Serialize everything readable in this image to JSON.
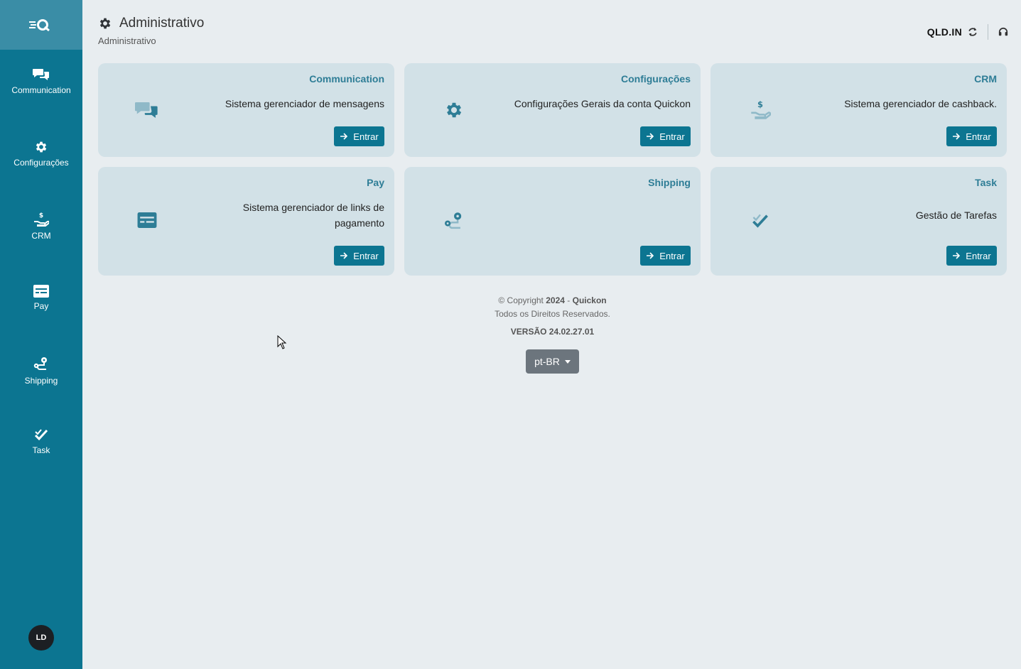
{
  "sidebar": {
    "logo": "logo-icon",
    "items": [
      {
        "label": "Communication",
        "icon": "chat-icon"
      },
      {
        "label": "Configurações",
        "icon": "gear-icon"
      },
      {
        "label": "CRM",
        "icon": "cashback-hand-icon"
      },
      {
        "label": "Pay",
        "icon": "card-icon"
      },
      {
        "label": "Shipping",
        "icon": "route-icon"
      },
      {
        "label": "Task",
        "icon": "check-icon"
      }
    ],
    "avatar": "LD"
  },
  "header": {
    "title": "Administrativo",
    "breadcrumb": "Administrativo",
    "org": "QLD.IN"
  },
  "cards": [
    {
      "title": "Communication",
      "description": "Sistema gerenciador de mensagens",
      "button": "Entrar",
      "icon": "chat-icon"
    },
    {
      "title": "Configurações",
      "description": "Configurações Gerais da conta Quickon",
      "button": "Entrar",
      "icon": "gear-icon"
    },
    {
      "title": "CRM",
      "description": "Sistema gerenciador de cashback.",
      "button": "Entrar",
      "icon": "cashback-hand-icon"
    },
    {
      "title": "Pay",
      "description": "Sistema gerenciador de links de pagamento",
      "button": "Entrar",
      "icon": "card-icon"
    },
    {
      "title": "Shipping",
      "description": "",
      "button": "Entrar",
      "icon": "route-icon"
    },
    {
      "title": "Task",
      "description": "Gestão de Tarefas",
      "button": "Entrar",
      "icon": "check-icon"
    }
  ],
  "footer": {
    "copyright_prefix": "© Copyright",
    "year": "2024",
    "separator": " - ",
    "company": "Quickon",
    "rights": "Todos os Direitos Reservados.",
    "version": "VERSÃO 24.02.27.01",
    "language": "pt-BR"
  },
  "colors": {
    "sidebar": "#0c7591",
    "accent": "#2e7d96",
    "card_bg": "#d2e1e7",
    "page_bg": "#e8edf0"
  }
}
